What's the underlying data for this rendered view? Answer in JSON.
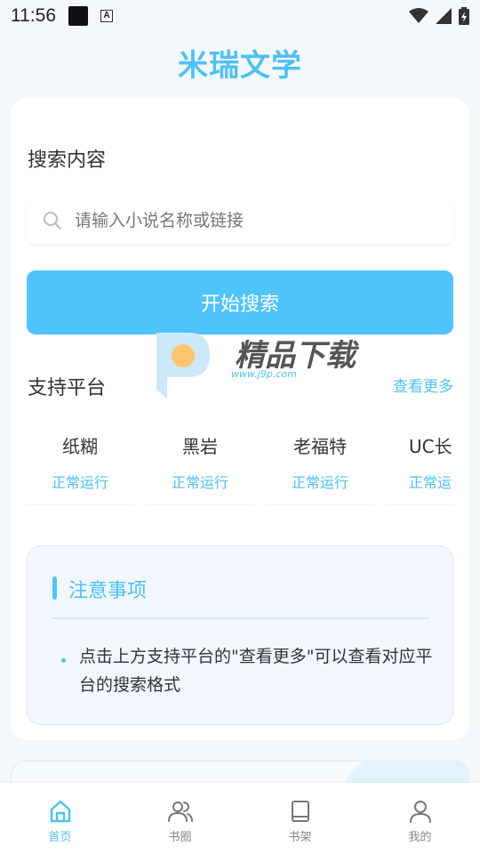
{
  "status": {
    "time": "11:56",
    "a_glyph": "A"
  },
  "app": {
    "title": "米瑞文学"
  },
  "search": {
    "label": "搜索内容",
    "placeholder": "请输入小说名称或链接",
    "button_label": "开始搜索"
  },
  "platforms": {
    "title": "支持平台",
    "more_label": "查看更多",
    "items": [
      {
        "name": "纸糊",
        "status": "正常运行"
      },
      {
        "name": "黑岩",
        "status": "正常运行"
      },
      {
        "name": "老福特",
        "status": "正常运行"
      },
      {
        "name": "UC长",
        "status": "正常运"
      }
    ]
  },
  "notice": {
    "title": "注意事项",
    "items": [
      "点击上方支持平台的\"查看更多\"可以查看对应平台的搜索格式"
    ]
  },
  "watermark": {
    "brand": "精品下载",
    "url": "www.j9p.com"
  },
  "tabs": [
    {
      "label": "首页",
      "icon": "home-icon",
      "active": true
    },
    {
      "label": "书圈",
      "icon": "users-icon",
      "active": false
    },
    {
      "label": "书架",
      "icon": "book-icon",
      "active": false
    },
    {
      "label": "我的",
      "icon": "user-icon",
      "active": false
    }
  ],
  "colors": {
    "accent": "#4fc3fc",
    "accent_text": "#4fc0f5",
    "inactive": "#888888"
  }
}
